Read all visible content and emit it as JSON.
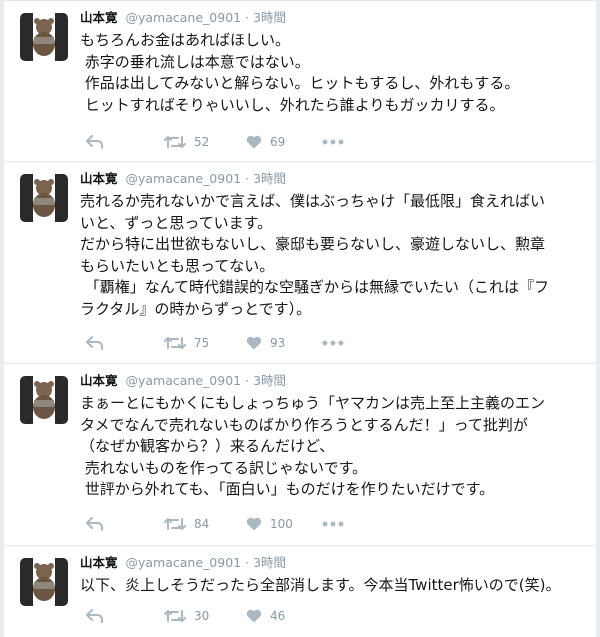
{
  "colors": {
    "background": "#e6ecf0",
    "card": "#ffffff",
    "text": "#14171a",
    "muted": "#8899a6",
    "icon": "#aab8c2"
  },
  "tweets": [
    {
      "author": "山本寛",
      "handle": "@yamacane_0901",
      "separator": "·",
      "time": "3時間",
      "text": "もちろんお金はあればほしい。\n 赤字の垂れ流しは本意ではない。\n 作品は出してみないと解らない。ヒットもするし、外れもする。\n ヒットすればそりゃいいし、外れたら誰よりもガッカリする。",
      "retweets": "52",
      "likes": "69"
    },
    {
      "author": "山本寛",
      "handle": "@yamacane_0901",
      "separator": "·",
      "time": "3時間",
      "text": "売れるか売れないかで言えば、僕はぶっちゃけ「最低限」食えればい\nいと、ずっと思っています。\nだから特に出世欲もないし、豪邸も要らないし、豪遊しないし、勲章\nもらいたいとも思ってない。\n 「覇権」なんて時代錯誤的な空騒ぎからは無縁でいたい（これは『フ\nラクタル』の時からずっとです）。",
      "retweets": "75",
      "likes": "93"
    },
    {
      "author": "山本寛",
      "handle": "@yamacane_0901",
      "separator": "·",
      "time": "3時間",
      "text": "まぁーとにもかくにもしょっちゅう「ヤマカンは売上至上主義のエン\nタメでなんで売れないものばかり作ろうとするんだ！」って批判が\n（なぜか観客から？）来るんだけど、\n 売れないものを作ってる訳じゃないです。\n 世評から外れても、「面白い」ものだけを作りたいだけです。",
      "retweets": "84",
      "likes": "100"
    },
    {
      "author": "山本寛",
      "handle": "@yamacane_0901",
      "separator": "·",
      "time": "3時間",
      "text": "以下、炎上しそうだったら全部消します。今本当Twitter怖いので(笑)。",
      "retweets": "30",
      "likes": "46"
    }
  ],
  "icons": {
    "avatar": "bear-plush-avatar",
    "reply": "reply-arrow-icon",
    "retweet": "retweet-icon",
    "like": "heart-icon",
    "more": "more-dots-icon"
  }
}
